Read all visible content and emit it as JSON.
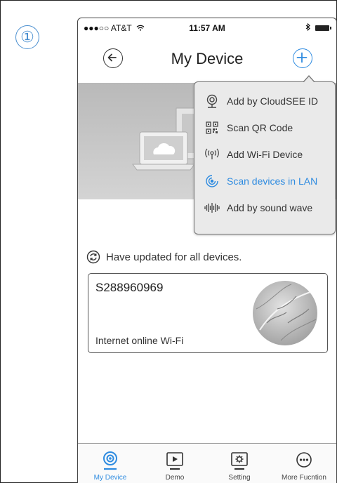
{
  "step_marker": "①",
  "status_bar": {
    "carrier": "●●●○○ AT&T",
    "time": "11:57 AM"
  },
  "navbar": {
    "title": "My Device",
    "back_icon": "arrow-left-circle",
    "add_icon": "plus-circle"
  },
  "add_menu": {
    "items": [
      {
        "label": "Add by CloudSEE ID",
        "icon": "webcam-icon",
        "active": false
      },
      {
        "label": "Scan QR Code",
        "icon": "qr-code-icon",
        "active": false
      },
      {
        "label": "Add Wi-Fi Device",
        "icon": "wifi-signal-icon",
        "active": false
      },
      {
        "label": "Scan devices in LAN",
        "icon": "radar-scan-icon",
        "active": true
      },
      {
        "label": "Add by sound wave",
        "icon": "sound-wave-icon",
        "active": false
      }
    ]
  },
  "update_notice": "Have updated for all devices.",
  "device_card": {
    "name": "S288960969",
    "status": "Internet online Wi-Fi"
  },
  "tabbar": {
    "tabs": [
      {
        "label": "My Device",
        "icon": "camera-icon",
        "active": true
      },
      {
        "label": "Demo",
        "icon": "play-screen-icon",
        "active": false
      },
      {
        "label": "Setting",
        "icon": "gear-screen-icon",
        "active": false
      },
      {
        "label": "More Fucntion",
        "icon": "more-dots-icon",
        "active": false
      }
    ]
  },
  "colors": {
    "accent": "#2e8be0",
    "text": "#333333",
    "menu_bg": "#eaeaea",
    "banner_bg": "#c4c4c4"
  }
}
